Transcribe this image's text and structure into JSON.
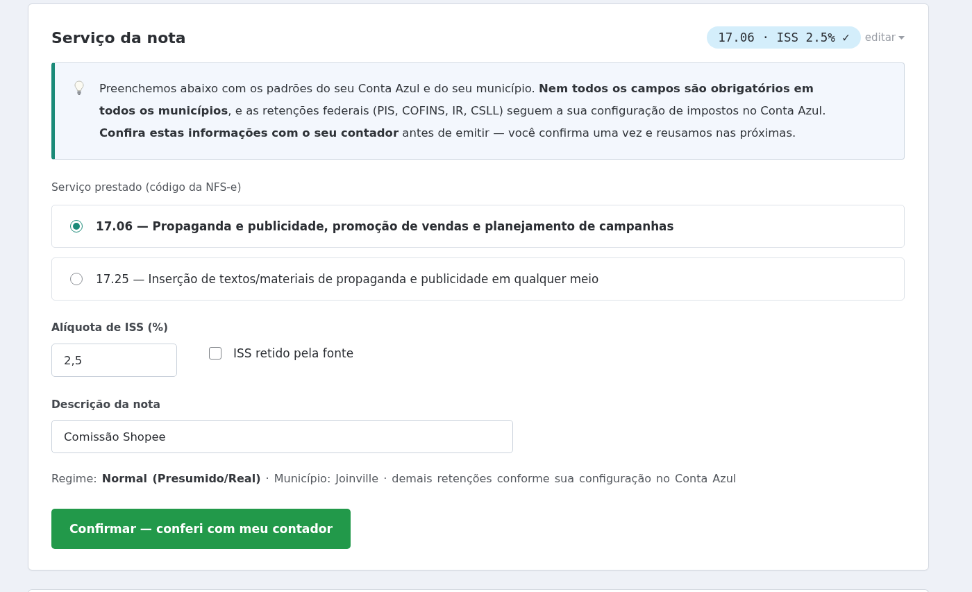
{
  "card": {
    "title": "Serviço da nota",
    "summary_badge": "17.06 · ISS 2.5% ✓",
    "edit_link": "editar"
  },
  "notice": {
    "text": "Preenchemos abaixo com os padrões do seu Conta Azul e do seu município. **Nem todos os campos são obrigatórios em todos os municípios**, e as retenções federais (PIS, COFINS, IR, CSLL) seguem a sua configuração de impostos no Conta Azul. **Confira estas informações com o seu contador** antes de emitir — você confirma uma vez e reusamos nas próximas."
  },
  "service": {
    "label": "Serviço prestado (código da NFS-e)",
    "options": [
      {
        "text": "17.06 — Propaganda e publicidade, promoção de vendas e planejamento de campanhas",
        "selected": true
      },
      {
        "text": "17.25 — Inserção de textos/materiais de propaganda e publicidade em qualquer meio",
        "selected": false
      }
    ]
  },
  "iss": {
    "label": "Alíquota de ISS (%)",
    "value": "2,5",
    "withheld": {
      "label": "ISS retido pela fonte",
      "checked": false
    }
  },
  "description": {
    "label": "Descrição da nota",
    "value": "Comissão Shopee"
  },
  "summary_line": "Regime: **Normal (Presumido/Real)** · Município: Joinville · demais retenções conforme sua configuração no Conta Azul",
  "confirm_button": "Confirmar — conferi com meu contador"
}
